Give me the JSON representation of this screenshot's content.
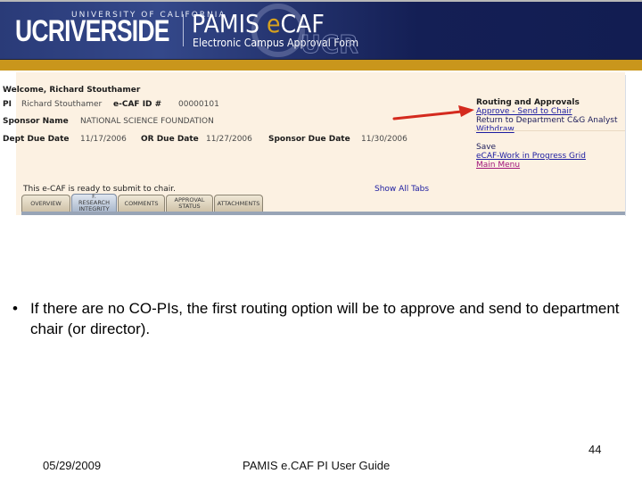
{
  "banner": {
    "logo_uc": "UCRIVERSIDE",
    "logo_university": "UNIVERSITY OF CALIFORNIA",
    "logo_pamis_prefix": "PAMIS ",
    "logo_pamis_e": "e",
    "logo_pamis_suffix": "CAF",
    "logo_subtitle": "Electronic Campus Approval Form",
    "logo_ucr": "UCR",
    "colors": {
      "navy": "#141f55",
      "gold": "#c9961c"
    }
  },
  "ecaf": {
    "welcome": "Welcome, Richard Stouthamer",
    "pi_label": "PI",
    "pi_value": "Richard Stouthamer",
    "ecaf_id_label": "e-CAF ID #",
    "ecaf_id_value": "00000101",
    "sponsor_label": "Sponsor Name",
    "sponsor_value": "NATIONAL SCIENCE FOUNDATION",
    "dept_due_label": "Dept Due Date",
    "dept_due_value": "11/17/2006",
    "or_due_label": "OR Due Date",
    "or_due_value": "11/27/2006",
    "sponsor_due_label": "Sponsor Due Date",
    "sponsor_due_value": "11/30/2006",
    "status_message": "This e-CAF is ready to submit to chair.",
    "show_all_tabs": "Show All Tabs",
    "routing": {
      "heading": "Routing and Approvals",
      "approve_send": "Approve - Send to Chair",
      "return_analyst": "Return to Department C&G Analyst",
      "withdraw": "Withdraw"
    },
    "actions": {
      "save": "Save",
      "wip_grid": "eCAF-Work in Progress Grid",
      "main_menu": "Main Menu"
    },
    "tabs": [
      {
        "label": "OVERVIEW",
        "active": false
      },
      {
        "label": "F. RESEARCH INTEGRITY",
        "active": true
      },
      {
        "label": "COMMENTS",
        "active": false
      },
      {
        "label": "APPROVAL STATUS",
        "active": false
      },
      {
        "label": "ATTACHMENTS",
        "active": false
      }
    ]
  },
  "slide": {
    "bullet_symbol": "•",
    "bullet_text": "If there are no CO-PIs, the first routing option will be to approve and send to department chair (or director).",
    "footer_date": "05/29/2009",
    "footer_title": "PAMIS e.CAF PI User Guide",
    "page_number": "44"
  }
}
